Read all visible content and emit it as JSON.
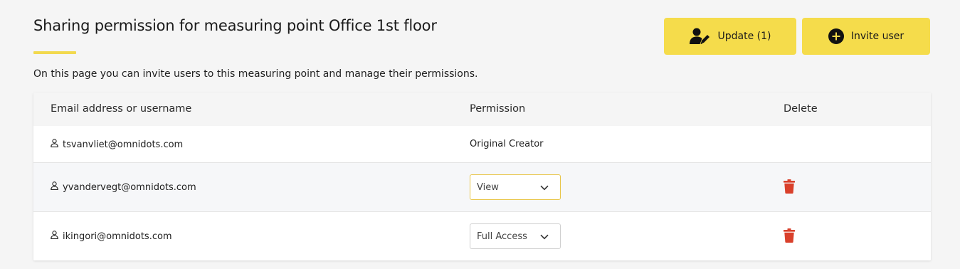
{
  "header": {
    "title": "Sharing permission for measuring point Office 1st floor",
    "description": "On this page you can invite users to this measuring point and manage their permissions."
  },
  "actions": {
    "update_label": "Update (1)",
    "invite_label": "Invite user"
  },
  "table": {
    "columns": [
      "Email address or username",
      "Permission",
      "Delete"
    ],
    "rows": [
      {
        "email": "tsvanvliet@omnidots.com",
        "permission": "Original Creator",
        "editable": false
      },
      {
        "email": "yvandervegt@omnidots.com",
        "permission": "View",
        "editable": true
      },
      {
        "email": "ikingori@omnidots.com",
        "permission": "Full Access",
        "editable": true
      }
    ]
  },
  "colors": {
    "accent": "#f5dc4b",
    "delete": "#d9402b",
    "focused_border": "#e8c547"
  },
  "icons": {
    "update": "user-edit-icon",
    "invite": "plus-circle-icon",
    "user": "user-icon",
    "dropdown": "chevron-down-icon",
    "delete": "trash-icon"
  }
}
